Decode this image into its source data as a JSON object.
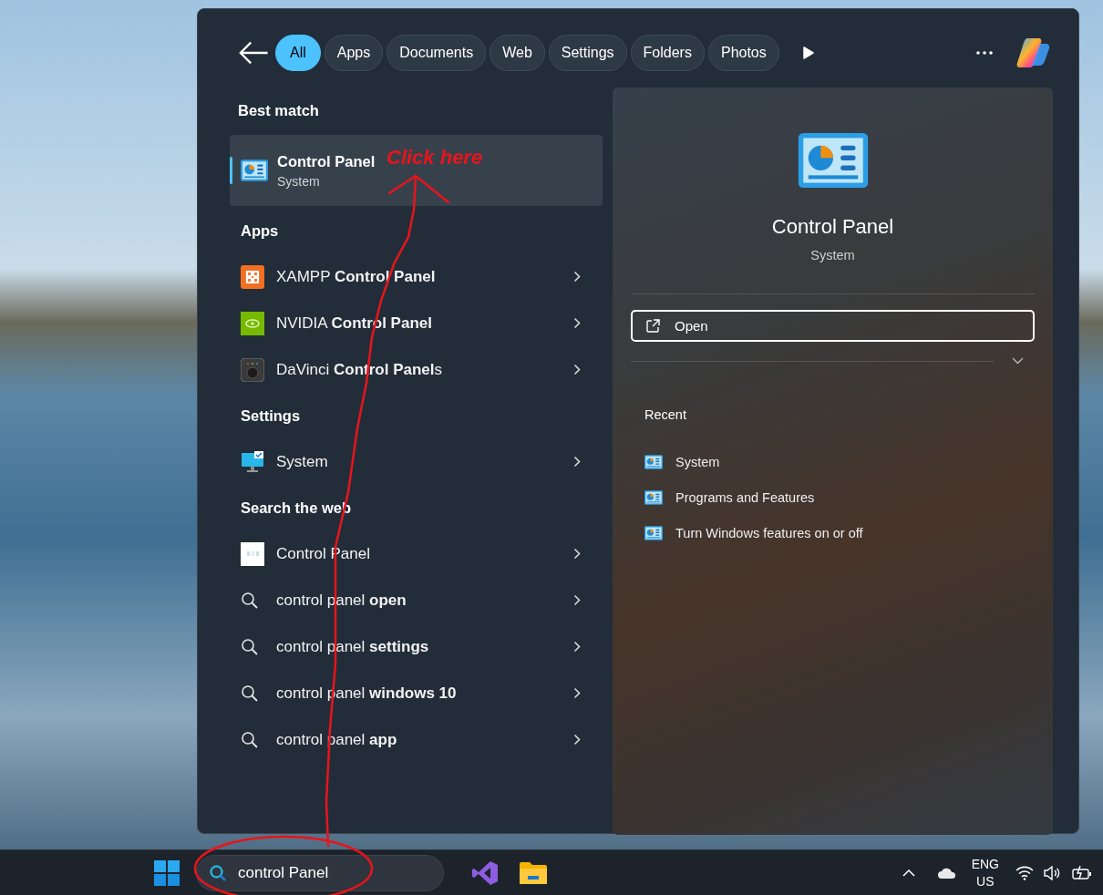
{
  "filter_tabs": [
    {
      "label": "All",
      "selected": true
    },
    {
      "label": "Apps",
      "selected": false
    },
    {
      "label": "Documents",
      "selected": false
    },
    {
      "label": "Web",
      "selected": false
    },
    {
      "label": "Settings",
      "selected": false
    },
    {
      "label": "Folders",
      "selected": false
    },
    {
      "label": "Photos",
      "selected": false
    }
  ],
  "best_match": {
    "heading": "Best match",
    "title": "Control Panel",
    "subtitle": "System",
    "selected": true
  },
  "sections": [
    {
      "heading": "Apps",
      "items": [
        {
          "kind": "xampp",
          "label": "XAMPP **Control Panel**"
        },
        {
          "kind": "nvidia",
          "label": "NVIDIA **Control Panel**"
        },
        {
          "kind": "davinci",
          "label": "DaVinci **Control Panel**s"
        }
      ]
    },
    {
      "heading": "Settings",
      "items": [
        {
          "kind": "system",
          "label": "System"
        }
      ]
    },
    {
      "heading": "Search the web",
      "items": [
        {
          "kind": "web",
          "label": "Control Panel"
        },
        {
          "kind": "search",
          "label": "control panel **open**"
        },
        {
          "kind": "search",
          "label": "control panel **settings**"
        },
        {
          "kind": "search",
          "label": "control panel **windows 10**"
        },
        {
          "kind": "search",
          "label": "control panel **app**"
        }
      ]
    }
  ],
  "detail": {
    "title": "Control Panel",
    "subtitle": "System",
    "open_label": "Open",
    "recent_heading": "Recent",
    "recent": [
      "System",
      "Programs and Features",
      "Turn Windows features on or off"
    ]
  },
  "taskbar": {
    "search_value": "control Panel",
    "language": "ENG",
    "region": "US"
  },
  "annotation": {
    "text": "Click here"
  }
}
